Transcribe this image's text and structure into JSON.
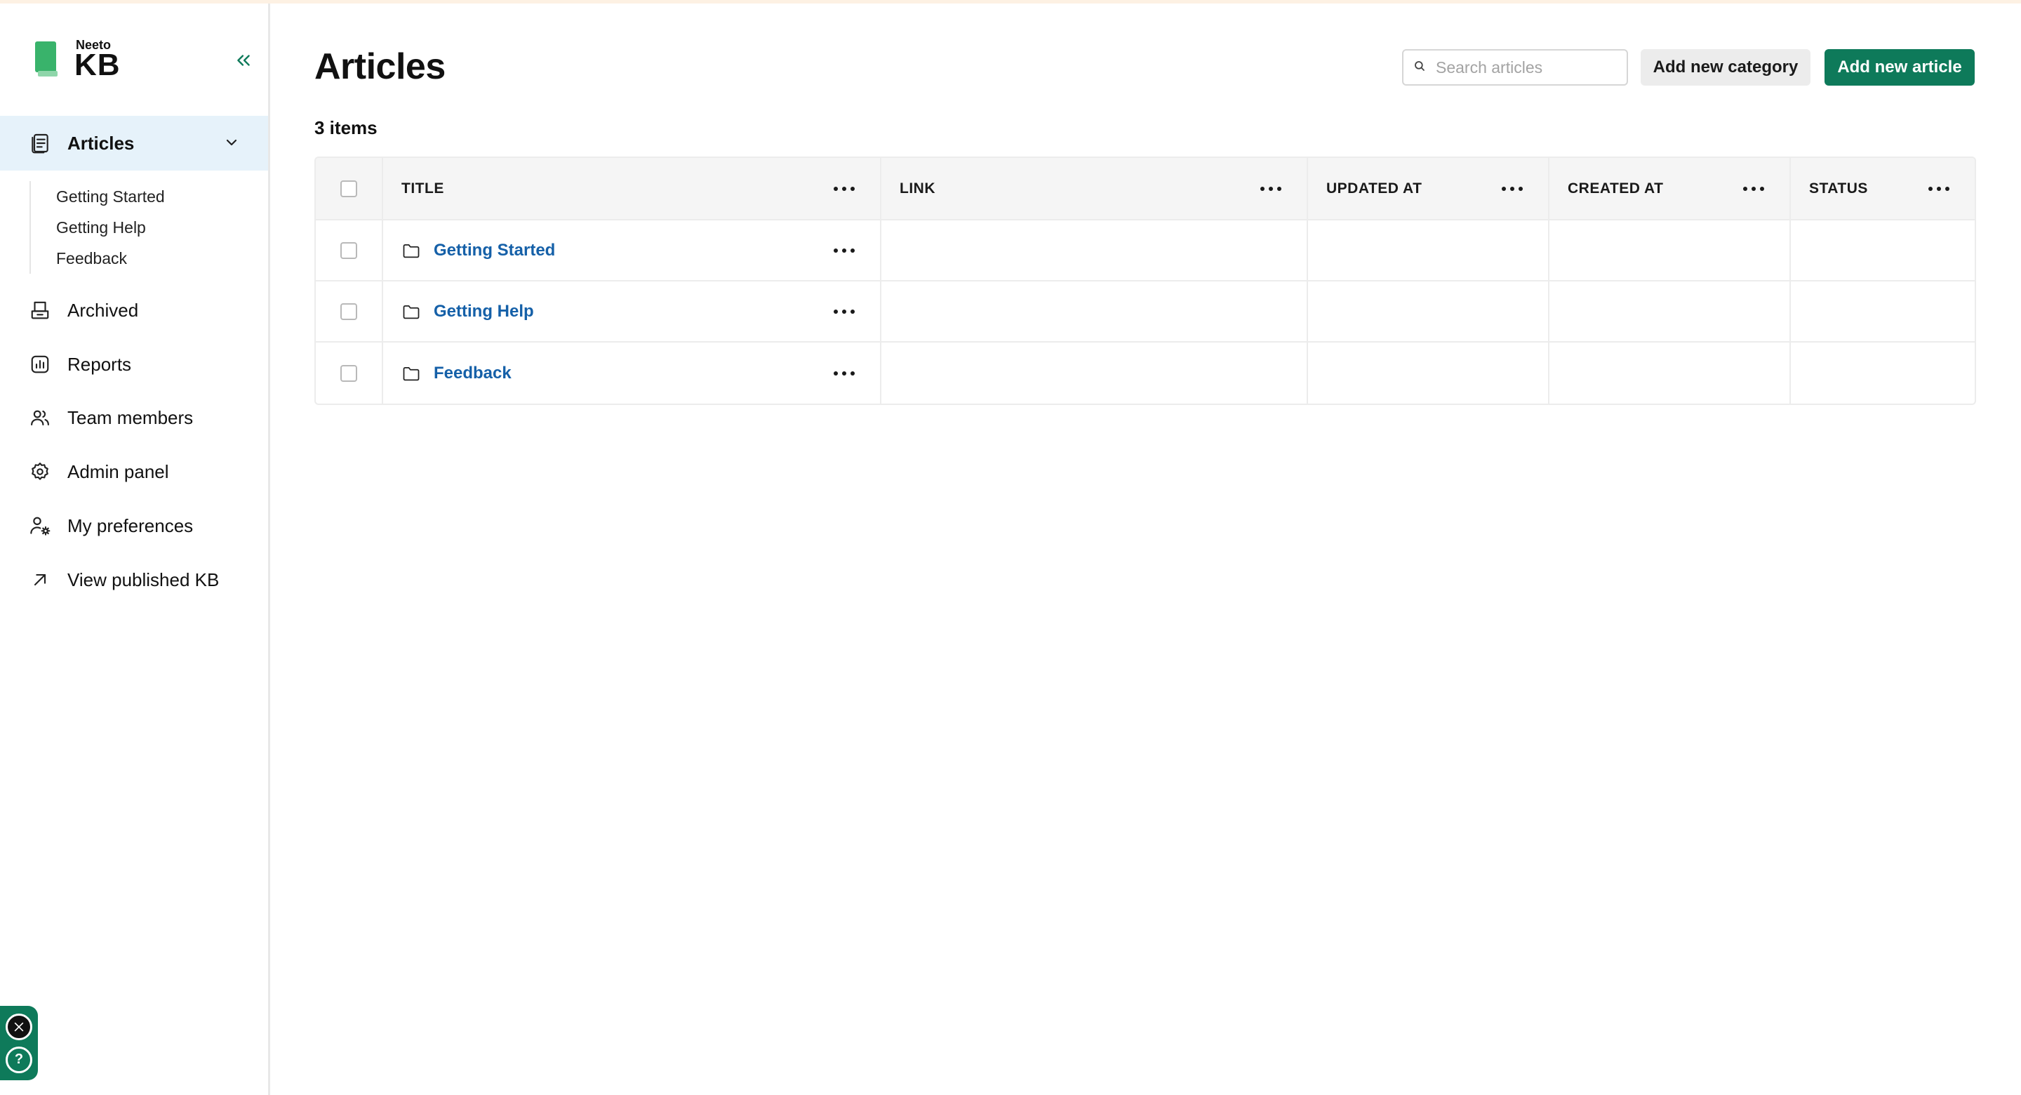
{
  "brand": {
    "small": "Neeto",
    "big": "KB"
  },
  "sidebar": {
    "articles_label": "Articles",
    "sub_items": [
      "Getting Started",
      "Getting Help",
      "Feedback"
    ],
    "items": [
      {
        "label": "Archived",
        "icon": "archive-icon"
      },
      {
        "label": "Reports",
        "icon": "reports-icon"
      },
      {
        "label": "Team members",
        "icon": "team-icon"
      },
      {
        "label": "Admin panel",
        "icon": "gear-icon"
      },
      {
        "label": "My preferences",
        "icon": "user-settings-icon"
      },
      {
        "label": "View published KB",
        "icon": "external-arrow-icon"
      }
    ]
  },
  "header": {
    "title": "Articles",
    "count": "3 items",
    "search_placeholder": "Search articles",
    "add_category": "Add new category",
    "add_article": "Add new article"
  },
  "table": {
    "columns": [
      "TITLE",
      "LINK",
      "UPDATED AT",
      "CREATED AT",
      "STATUS"
    ],
    "rows": [
      {
        "title": "Getting Started",
        "link": "",
        "updated_at": "",
        "created_at": "",
        "status": ""
      },
      {
        "title": "Getting Help",
        "link": "",
        "updated_at": "",
        "created_at": "",
        "status": ""
      },
      {
        "title": "Feedback",
        "link": "",
        "updated_at": "",
        "created_at": "",
        "status": ""
      }
    ]
  },
  "colors": {
    "accent": "#0e7a5a",
    "link": "#1560a8",
    "active_bg": "#e6f2fa"
  }
}
